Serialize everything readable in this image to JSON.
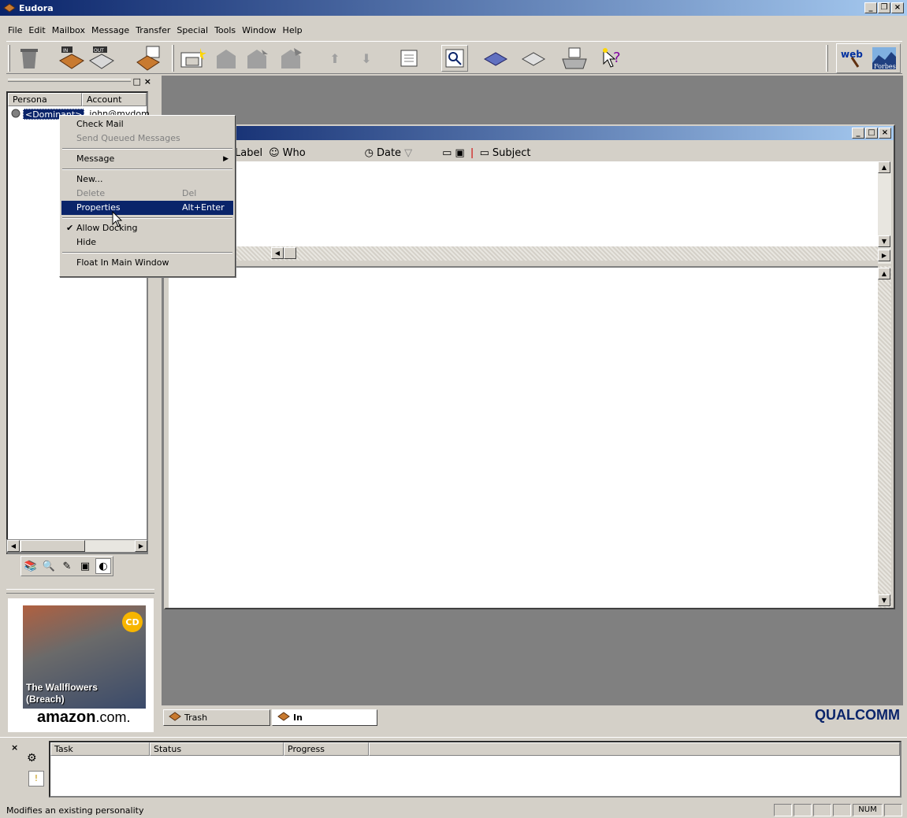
{
  "window": {
    "title": "Eudora",
    "controls": [
      "_",
      "▫",
      "×"
    ]
  },
  "menu": [
    "File",
    "Edit",
    "Mailbox",
    "Message",
    "Transfer",
    "Special",
    "Tools",
    "Window",
    "Help"
  ],
  "toolbar": {
    "icons": [
      "delete-icon",
      "check-mail-icon",
      "send-queued-icon",
      "compose-icon",
      "new-message-icon",
      "reply-icon",
      "reply-all-icon",
      "forward-icon",
      "previous-icon",
      "next-icon",
      "attach-icon",
      "find-icon",
      "address-book-icon",
      "print-icon",
      "help-icon"
    ],
    "in_label": "IN",
    "out_label": "OUT"
  },
  "personalities": {
    "columns": [
      "Persona",
      "Account"
    ],
    "rows": [
      {
        "persona": "<Dominant>",
        "account": "john@mydom"
      }
    ]
  },
  "context_menu": {
    "items": [
      {
        "label": "Check Mail",
        "accel": "",
        "enabled": true
      },
      {
        "label": "Send Queued Messages",
        "accel": "",
        "enabled": false
      },
      {
        "label": "Message",
        "accel": "",
        "enabled": true,
        "submenu": true
      },
      {
        "label": "New...",
        "accel": "",
        "enabled": true
      },
      {
        "label": "Delete",
        "accel": "Del",
        "enabled": false
      },
      {
        "label": "Properties",
        "accel": "Alt+Enter",
        "enabled": true,
        "highlighted": true
      },
      {
        "label": "Allow Docking",
        "accel": "",
        "enabled": true,
        "checked": true
      },
      {
        "label": "Hide",
        "accel": "",
        "enabled": true
      },
      {
        "label": "Float In Main Window",
        "accel": "",
        "enabled": true
      }
    ]
  },
  "mailbox": {
    "columns": [
      "Label",
      "Who",
      "Date",
      "Subject"
    ]
  },
  "window_tabs": [
    {
      "label": "Trash",
      "active": false
    },
    {
      "label": "In",
      "active": true
    }
  ],
  "brand": "QUALCOMM",
  "ad": {
    "badge": "CD",
    "album_line1": "The Wallflowers",
    "album_line2": "(Breach)",
    "store": "amazon",
    "store_suffix": ".com."
  },
  "task_status": {
    "columns": [
      "Task",
      "Status",
      "Progress"
    ]
  },
  "status_bar": {
    "text": "Modifies an existing personality",
    "num": "NUM"
  },
  "colors": {
    "title_active": "#0a246a",
    "selection": "#0a246a",
    "workspace": "#808080",
    "face": "#d4d0c8"
  }
}
